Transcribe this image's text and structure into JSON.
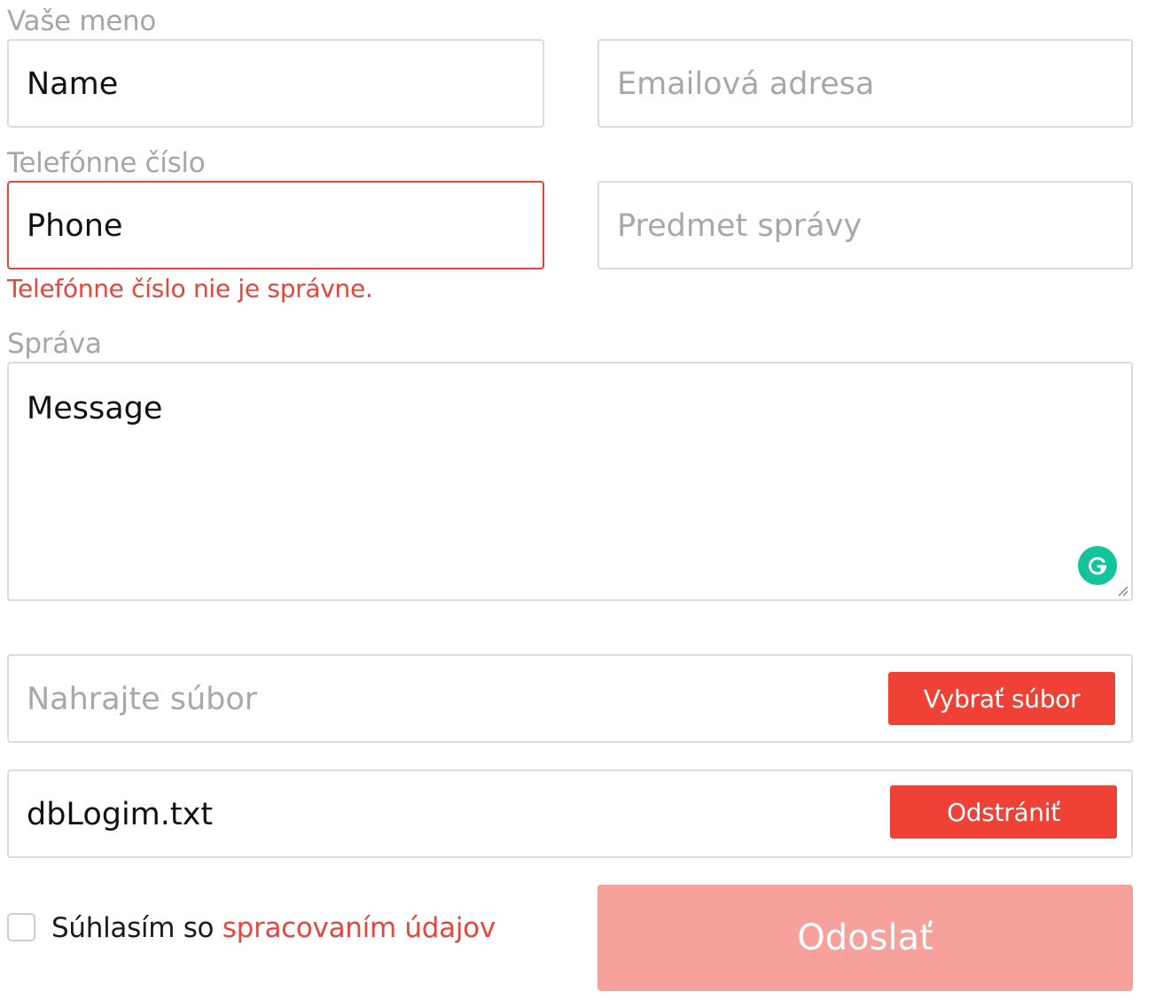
{
  "form": {
    "name": {
      "label": "Vaše meno",
      "value": "Name"
    },
    "email": {
      "placeholder": "Emailová adresa"
    },
    "phone": {
      "label": "Telefónne číslo",
      "value": "Phone",
      "error": "Telefónne číslo nie je správne."
    },
    "subject": {
      "placeholder": "Predmet správy"
    },
    "message": {
      "label": "Správa",
      "value": "Message"
    },
    "upload": {
      "placeholder": "Nahrajte súbor",
      "button_label": "Vybrať súbor"
    },
    "attached_file": {
      "filename": "dbLogim.txt",
      "remove_label": "Odstrániť"
    },
    "consent": {
      "checked": false,
      "text": "Súhlasím so",
      "link_text": "spracovaním údajov"
    },
    "submit_label": "Odoslať"
  },
  "icons": {
    "grammarly": "grammarly-icon",
    "resize": "resize-handle-icon"
  },
  "colors": {
    "accent": "#ef4136",
    "submit_disabled": "#f6a19b",
    "label": "#a6a6a6",
    "border": "#dcdcdc",
    "grammarly": "#15c39a"
  }
}
